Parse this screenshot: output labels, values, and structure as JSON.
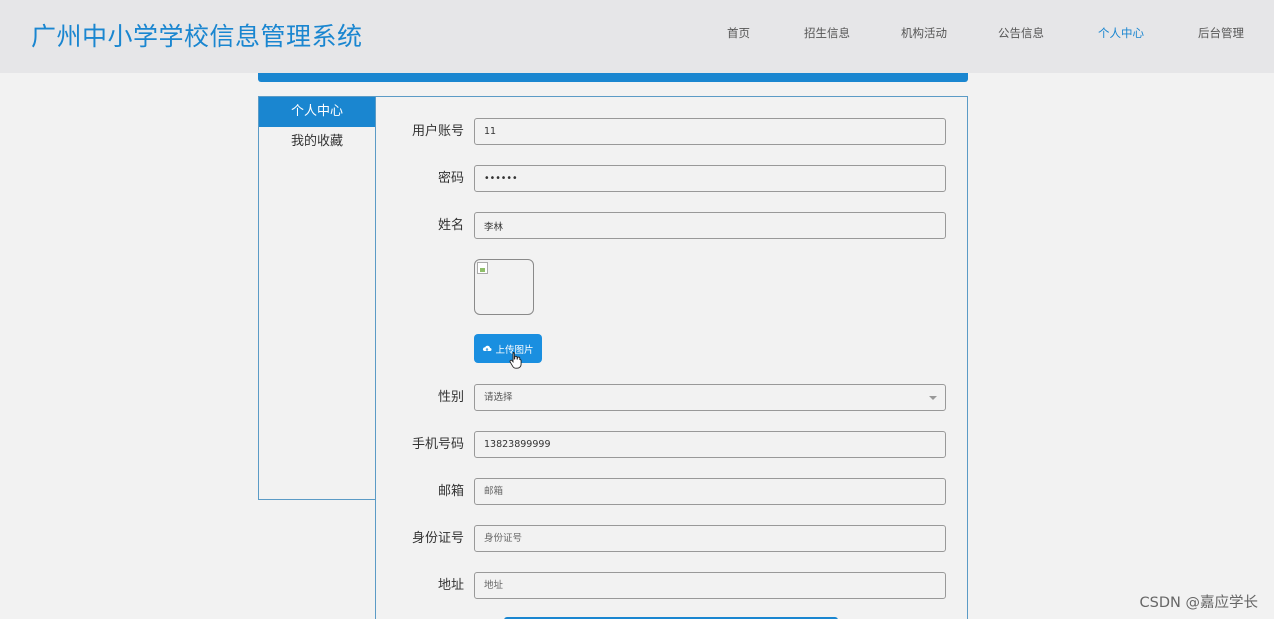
{
  "header": {
    "title": "广州中小学学校信息管理系统",
    "nav": [
      {
        "label": "首页",
        "active": false
      },
      {
        "label": "招生信息",
        "active": false
      },
      {
        "label": "机构活动",
        "active": false
      },
      {
        "label": "公告信息",
        "active": false
      },
      {
        "label": "个人中心",
        "active": true
      },
      {
        "label": "后台管理",
        "active": false
      }
    ]
  },
  "sidebar": {
    "items": [
      {
        "label": "个人中心",
        "active": true
      },
      {
        "label": "我的收藏",
        "active": false
      }
    ]
  },
  "form": {
    "account": {
      "label": "用户账号",
      "value": "11"
    },
    "password": {
      "label": "密码",
      "value": "••••••"
    },
    "name": {
      "label": "姓名",
      "value": "李林"
    },
    "upload": {
      "label": "上传图片"
    },
    "gender": {
      "label": "性别",
      "value": "请选择"
    },
    "phone": {
      "label": "手机号码",
      "value": "13823899999"
    },
    "email": {
      "label": "邮箱",
      "placeholder": "邮箱"
    },
    "idcard": {
      "label": "身份证号",
      "placeholder": "身份证号"
    },
    "address": {
      "label": "地址",
      "placeholder": "地址"
    }
  },
  "watermark": "CSDN @嘉应学长",
  "colors": {
    "accent": "#1a86d0",
    "background": "#f2f2f2",
    "header": "#e6e6e8"
  }
}
